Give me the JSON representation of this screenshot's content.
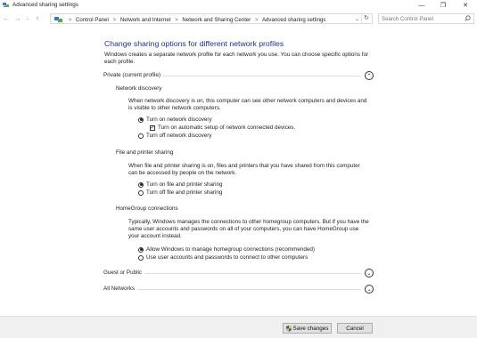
{
  "window": {
    "title": "Advanced sharing settings",
    "icon": "network-sharing-icon",
    "minimize": "—",
    "maximize": "❐",
    "close": "✕"
  },
  "address": {
    "crumbs": [
      "Control Panel",
      "Network and Internet",
      "Network and Sharing Center",
      "Advanced sharing settings"
    ],
    "separator": ">",
    "search_placeholder": "Search Control Panel"
  },
  "page": {
    "title": "Change sharing options for different network profiles",
    "intro": "Windows creates a separate network profile for each network you use. You can choose specific options for each profile."
  },
  "profiles": {
    "private": {
      "label": "Private (current profile)",
      "expanded": true,
      "network_discovery": {
        "heading": "Network discovery",
        "desc": "When network discovery is on, this computer can see other network computers and devices and is visible to other network computers.",
        "on": "Turn on network discovery",
        "auto_setup": "Turn on automatic setup of network connected devices.",
        "off": "Turn off network discovery",
        "selected": "on",
        "auto_setup_checked": true
      },
      "file_printer": {
        "heading": "File and printer sharing",
        "desc": "When file and printer sharing is on, files and printers that you have shared from this computer can be accessed by people on the network.",
        "on": "Turn on file and printer sharing",
        "off": "Turn off file and printer sharing",
        "selected": "on"
      },
      "homegroup": {
        "heading": "HomeGroup connections",
        "desc": "Typically, Windows manages the connections to other homegroup computers. But if you have the same user accounts and passwords on all of your computers, you can have HomeGroup use your account instead.",
        "allow": "Allow Windows to manage homegroup connections (recommended)",
        "use_accounts": "Use user accounts and passwords to connect to other computers",
        "selected": "allow"
      }
    },
    "guest": {
      "label": "Guest or Public",
      "expanded": false
    },
    "all": {
      "label": "All Networks",
      "expanded": false
    }
  },
  "buttons": {
    "save": "Save changes",
    "cancel": "Cancel"
  },
  "colors": {
    "title_blue": "#1e3287",
    "shield_blue": "#2b5fb4",
    "shield_yellow": "#f2c12e"
  }
}
